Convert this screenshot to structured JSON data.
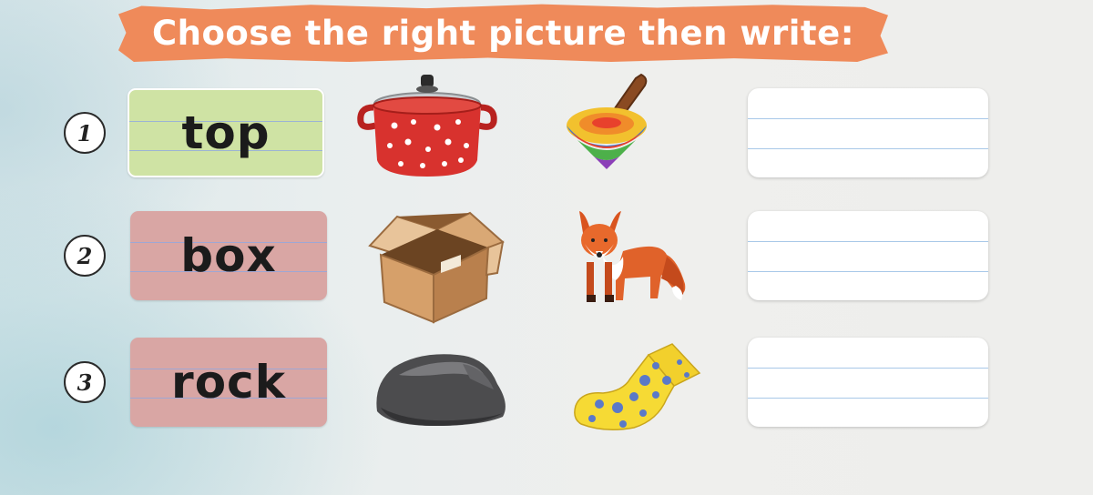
{
  "title": "Choose the right picture then write:",
  "rows": [
    {
      "number": "1",
      "word": "top",
      "options": [
        {
          "icon": "red-pot-icon"
        },
        {
          "icon": "spinning-top-icon"
        }
      ],
      "answer": ""
    },
    {
      "number": "2",
      "word": "box",
      "options": [
        {
          "icon": "cardboard-box-icon"
        },
        {
          "icon": "fox-icon"
        }
      ],
      "answer": ""
    },
    {
      "number": "3",
      "word": "rock",
      "options": [
        {
          "icon": "rock-icon"
        },
        {
          "icon": "sock-icon"
        }
      ],
      "answer": ""
    }
  ],
  "colors": {
    "banner": "#ef8a5a",
    "card_selected": "#cfe3a4",
    "card_default": "#d9a6a4"
  }
}
